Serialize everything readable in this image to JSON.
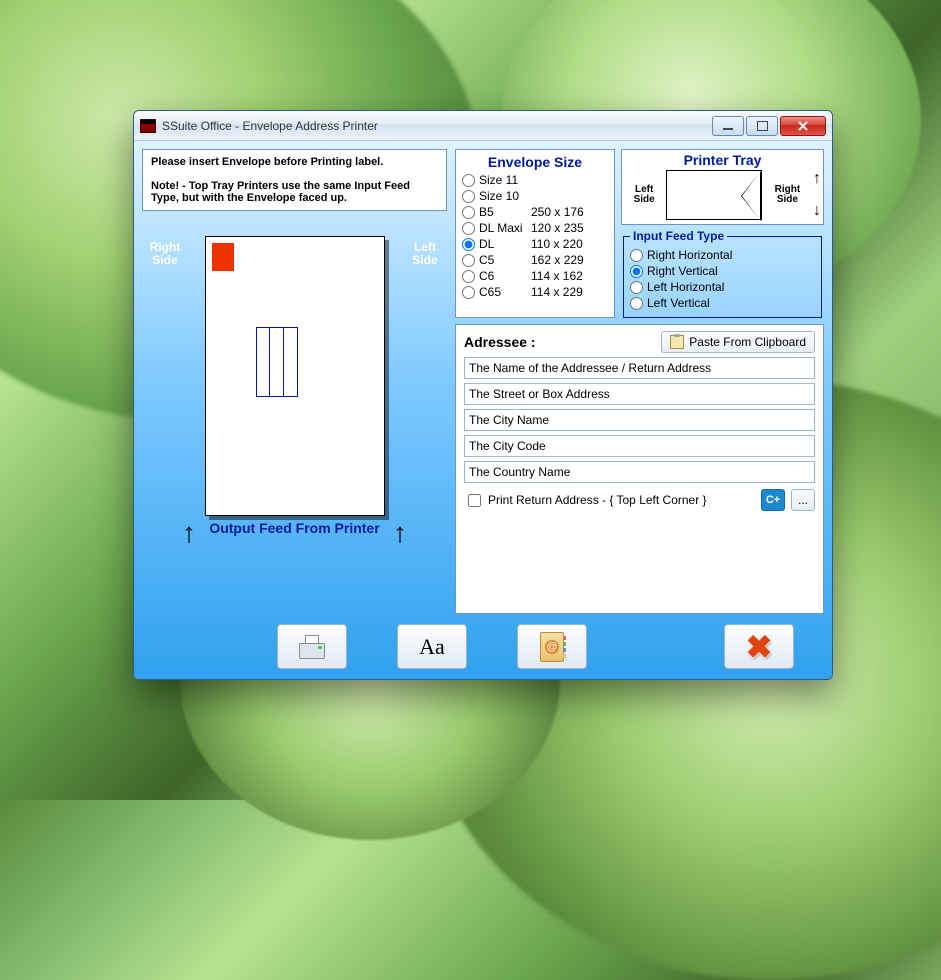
{
  "window": {
    "title": "SSuite Office - Envelope Address Printer"
  },
  "info": {
    "line1": "Please insert Envelope before Printing label.",
    "line2": "Note!  -  Top Tray Printers use the same Input Feed Type, but  with the Envelope faced up."
  },
  "preview": {
    "right_label": "Right Side",
    "left_label": "Left Side",
    "output_label": "Output Feed From Printer"
  },
  "envelope_size": {
    "title": "Envelope Size",
    "selected": "DL",
    "options": [
      {
        "name": "Size 11",
        "dims": ""
      },
      {
        "name": "Size 10",
        "dims": ""
      },
      {
        "name": "B5",
        "dims": "250 x 176"
      },
      {
        "name": "DL Maxi",
        "dims": "120 x 235"
      },
      {
        "name": "DL",
        "dims": "110 x 220"
      },
      {
        "name": "C5",
        "dims": "162 x 229"
      },
      {
        "name": "C6",
        "dims": "114 x 162"
      },
      {
        "name": "C65",
        "dims": "114 x 229"
      }
    ]
  },
  "printer_tray": {
    "title": "Printer Tray",
    "left": "Left Side",
    "right": "Right Side"
  },
  "input_feed": {
    "legend": "Input Feed Type",
    "selected": "Right Vertical",
    "options": [
      "Right Horizontal",
      "Right Vertical",
      "Left Horizontal",
      "Left Vertical"
    ]
  },
  "addressee": {
    "label": "Adressee :",
    "paste_button": "Paste From Clipboard",
    "fields": {
      "name": "The Name of the Addressee / Return Address",
      "street": "The Street or Box Address",
      "city": "The City Name",
      "code": "The City Code",
      "country": "The Country Name"
    },
    "return_checkbox": "Print Return Address - { Top Left Corner }",
    "return_checked": false,
    "cplus": "C+",
    "ellipsis": "..."
  }
}
